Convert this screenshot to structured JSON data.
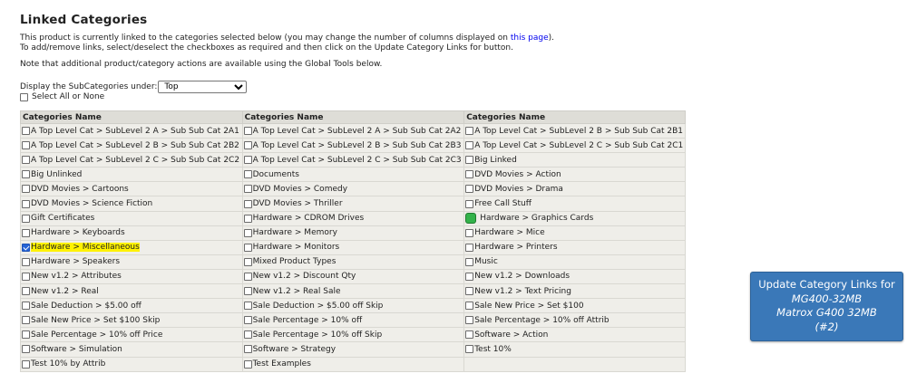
{
  "page": {
    "title": "Linked Categories",
    "intro_line1_before": "This product is currently linked to the categories selected below (you may change the number of columns displayed on ",
    "intro_link": "this page",
    "intro_line1_after": ").",
    "intro_line2": "To add/remove links, select/deselect the checkboxes as required and then click on the Update Category Links for button.",
    "note": "Note that additional product/category actions are available using the Global Tools below.",
    "subcat_label": "Display the SubCategories under:",
    "subcat_selected": "Top",
    "select_all_label": "Select All or None"
  },
  "table": {
    "headers": [
      "Categories Name",
      "Categories Name",
      "Categories Name"
    ],
    "rows": [
      [
        {
          "label": "A Top Level Cat > SubLevel 2 A > Sub Sub Cat 2A1",
          "state": "unchecked"
        },
        {
          "label": "A Top Level Cat > SubLevel 2 A > Sub Sub Cat 2A2",
          "state": "unchecked"
        },
        {
          "label": "A Top Level Cat > SubLevel 2 B > Sub Sub Cat 2B1",
          "state": "unchecked"
        }
      ],
      [
        {
          "label": "A Top Level Cat > SubLevel 2 B > Sub Sub Cat 2B2",
          "state": "unchecked"
        },
        {
          "label": "A Top Level Cat > SubLevel 2 B > Sub Sub Cat 2B3",
          "state": "unchecked"
        },
        {
          "label": "A Top Level Cat > SubLevel 2 C > Sub Sub Cat 2C1",
          "state": "unchecked"
        }
      ],
      [
        {
          "label": "A Top Level Cat > SubLevel 2 C > Sub Sub Cat 2C2",
          "state": "unchecked"
        },
        {
          "label": "A Top Level Cat > SubLevel 2 C > Sub Sub Cat 2C3",
          "state": "unchecked"
        },
        {
          "label": "Big Linked",
          "state": "unchecked"
        }
      ],
      [
        {
          "label": "Big Unlinked",
          "state": "unchecked"
        },
        {
          "label": "Documents",
          "state": "unchecked"
        },
        {
          "label": "DVD Movies > Action",
          "state": "unchecked"
        }
      ],
      [
        {
          "label": "DVD Movies > Cartoons",
          "state": "unchecked"
        },
        {
          "label": "DVD Movies > Comedy",
          "state": "unchecked"
        },
        {
          "label": "DVD Movies > Drama",
          "state": "unchecked"
        }
      ],
      [
        {
          "label": "DVD Movies > Science Fiction",
          "state": "unchecked"
        },
        {
          "label": "DVD Movies > Thriller",
          "state": "unchecked"
        },
        {
          "label": "Free Call Stuff",
          "state": "unchecked"
        }
      ],
      [
        {
          "label": "Gift Certificates",
          "state": "unchecked"
        },
        {
          "label": "Hardware > CDROM Drives",
          "state": "unchecked"
        },
        {
          "label": "Hardware > Graphics Cards",
          "state": "master"
        }
      ],
      [
        {
          "label": "Hardware > Keyboards",
          "state": "unchecked"
        },
        {
          "label": "Hardware > Memory",
          "state": "unchecked"
        },
        {
          "label": "Hardware > Mice",
          "state": "unchecked"
        }
      ],
      [
        {
          "label": "Hardware > Miscellaneous",
          "state": "checked"
        },
        {
          "label": "Hardware > Monitors",
          "state": "unchecked"
        },
        {
          "label": "Hardware > Printers",
          "state": "unchecked"
        }
      ],
      [
        {
          "label": "Hardware > Speakers",
          "state": "unchecked"
        },
        {
          "label": "Mixed Product Types",
          "state": "unchecked"
        },
        {
          "label": "Music",
          "state": "unchecked"
        }
      ],
      [
        {
          "label": "New v1.2 > Attributes",
          "state": "unchecked"
        },
        {
          "label": "New v1.2 > Discount Qty",
          "state": "unchecked"
        },
        {
          "label": "New v1.2 > Downloads",
          "state": "unchecked"
        }
      ],
      [
        {
          "label": "New v1.2 > Real",
          "state": "unchecked"
        },
        {
          "label": "New v1.2 > Real Sale",
          "state": "unchecked"
        },
        {
          "label": "New v1.2 > Text Pricing",
          "state": "unchecked"
        }
      ],
      [
        {
          "label": "Sale Deduction > $5.00 off",
          "state": "unchecked"
        },
        {
          "label": "Sale Deduction > $5.00 off Skip",
          "state": "unchecked"
        },
        {
          "label": "Sale New Price > Set $100",
          "state": "unchecked"
        }
      ],
      [
        {
          "label": "Sale New Price > Set $100 Skip",
          "state": "unchecked"
        },
        {
          "label": "Sale Percentage > 10% off",
          "state": "unchecked"
        },
        {
          "label": "Sale Percentage > 10% off Attrib",
          "state": "unchecked"
        }
      ],
      [
        {
          "label": "Sale Percentage > 10% off Price",
          "state": "unchecked"
        },
        {
          "label": "Sale Percentage > 10% off Skip",
          "state": "unchecked"
        },
        {
          "label": "Software > Action",
          "state": "unchecked"
        }
      ],
      [
        {
          "label": "Software > Simulation",
          "state": "unchecked"
        },
        {
          "label": "Software > Strategy",
          "state": "unchecked"
        },
        {
          "label": "Test 10%",
          "state": "unchecked"
        }
      ],
      [
        {
          "label": "Test 10% by Attrib",
          "state": "unchecked"
        },
        {
          "label": "Test Examples",
          "state": "unchecked"
        },
        {
          "label": "",
          "state": "empty"
        }
      ]
    ]
  },
  "update_button": {
    "line1": "Update Category Links for",
    "line2": "MG400-32MB",
    "line3": "Matrox G400 32MB",
    "line4": "(#2)"
  },
  "colors": {
    "highlight": "#fff200",
    "master_marker": "#33b24a",
    "button_bg": "#3a78b8",
    "link": "#0000ee"
  },
  "icons": {
    "master_category": "green-square-icon"
  }
}
